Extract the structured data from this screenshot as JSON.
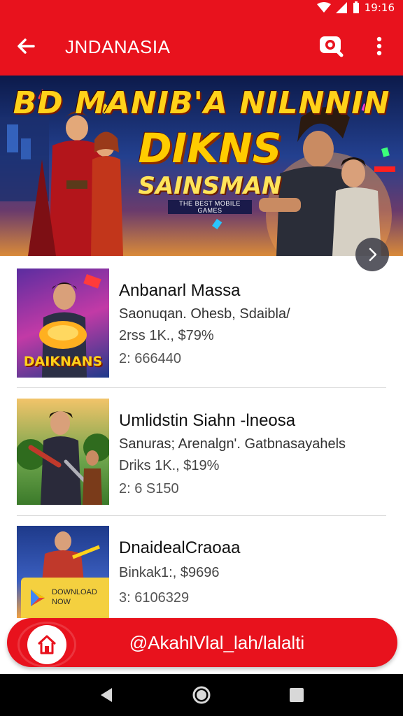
{
  "status_bar": {
    "time": "19:16"
  },
  "app_bar": {
    "title": "JNDANASIA"
  },
  "banner": {
    "title": "BD MANIB'A NILNNIN",
    "headline": "DIKNS",
    "subheadline": "SAINSMAN",
    "tagline": "THE BEST MOBILE GAMES"
  },
  "games": [
    {
      "title": "Anbanarl Massa",
      "description": "Saonuqan. Ohesb, Sdaibla/",
      "meta": "2rss 1K., $79%",
      "count": "2: 666440",
      "thumb_text": "DAIKNANS"
    },
    {
      "title": "Umlidstin Siahn ‑lneosa",
      "description": "Sanuras; Arenalgn'. Gatbnasayahels",
      "meta": "Driks 1K., $19%",
      "count": "2: 6 S150",
      "thumb_text": ""
    },
    {
      "title": "DnaidealCraoaa",
      "description": "",
      "meta": "Binkak1:, $9696",
      "count": "3: 6106329",
      "thumb_text": "DOWNLOAD NOW"
    }
  ],
  "action_bar": {
    "label": "@AkahlVlal_lah/lalalti"
  },
  "colors": {
    "brand_red": "#e8121d",
    "nav_black": "#000000"
  }
}
